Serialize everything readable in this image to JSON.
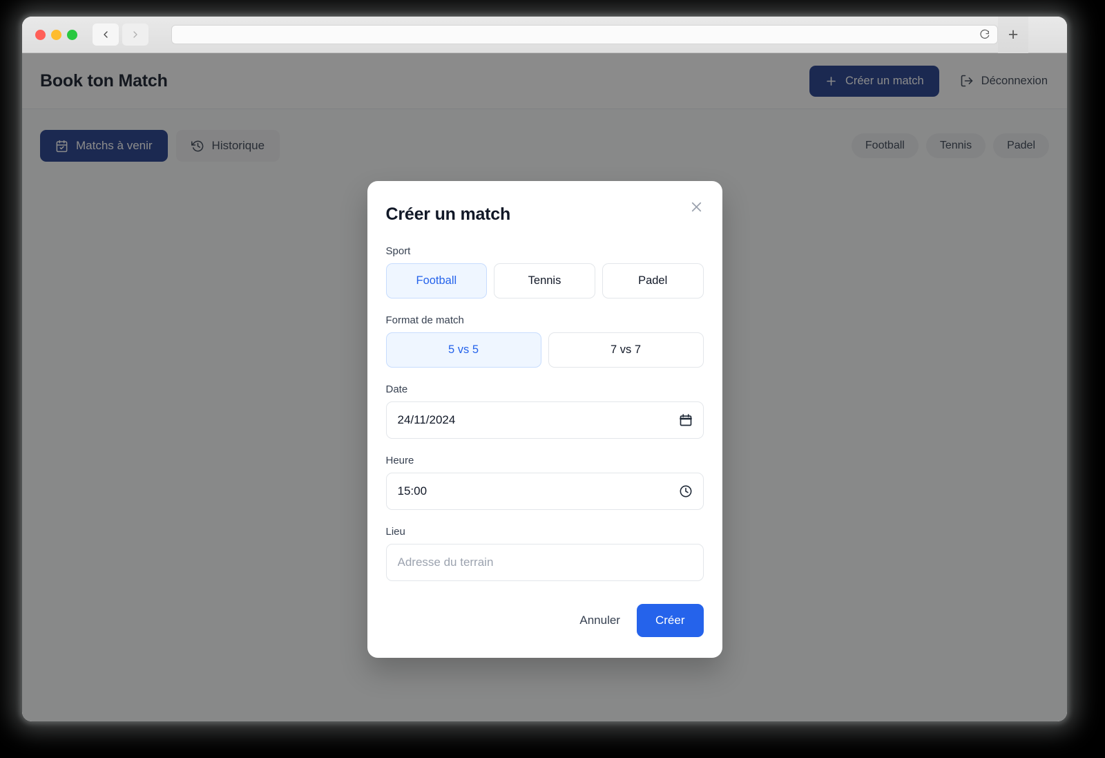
{
  "browser": {
    "back_icon": "chevron-left-icon",
    "forward_icon": "chevron-right-icon",
    "reload_icon": "reload-icon",
    "new_tab_label": "+",
    "url_value": ""
  },
  "header": {
    "title": "Book ton Match",
    "create_match_label": "Créer un match",
    "create_match_icon": "plus-icon",
    "logout_label": "Déconnexion",
    "logout_icon": "logout-icon",
    "create_match_color": "#1e3a8a"
  },
  "toolbar": {
    "tabs": [
      {
        "label": "Matchs à venir",
        "icon": "calendar-check-icon",
        "active": true
      },
      {
        "label": "Historique",
        "icon": "history-icon",
        "active": false
      }
    ],
    "filters": [
      {
        "label": "Football"
      },
      {
        "label": "Tennis"
      },
      {
        "label": "Padel"
      }
    ]
  },
  "modal": {
    "title": "Créer un match",
    "close_icon": "close-icon",
    "sport": {
      "label": "Sport",
      "options": [
        {
          "label": "Football",
          "selected": true
        },
        {
          "label": "Tennis",
          "selected": false
        },
        {
          "label": "Padel",
          "selected": false
        }
      ]
    },
    "format": {
      "label": "Format de match",
      "options": [
        {
          "label": "5 vs 5",
          "selected": true
        },
        {
          "label": "7 vs 7",
          "selected": false
        }
      ]
    },
    "date": {
      "label": "Date",
      "value": "24/11/2024",
      "icon": "calendar-icon"
    },
    "time": {
      "label": "Heure",
      "value": "15:00",
      "icon": "clock-icon"
    },
    "place": {
      "label": "Lieu",
      "value": "",
      "placeholder": "Adresse du terrain"
    },
    "cancel_label": "Annuler",
    "submit_label": "Créer",
    "submit_color": "#2563eb",
    "selected_accent": "#2563eb",
    "selected_bg": "#eff6ff"
  }
}
